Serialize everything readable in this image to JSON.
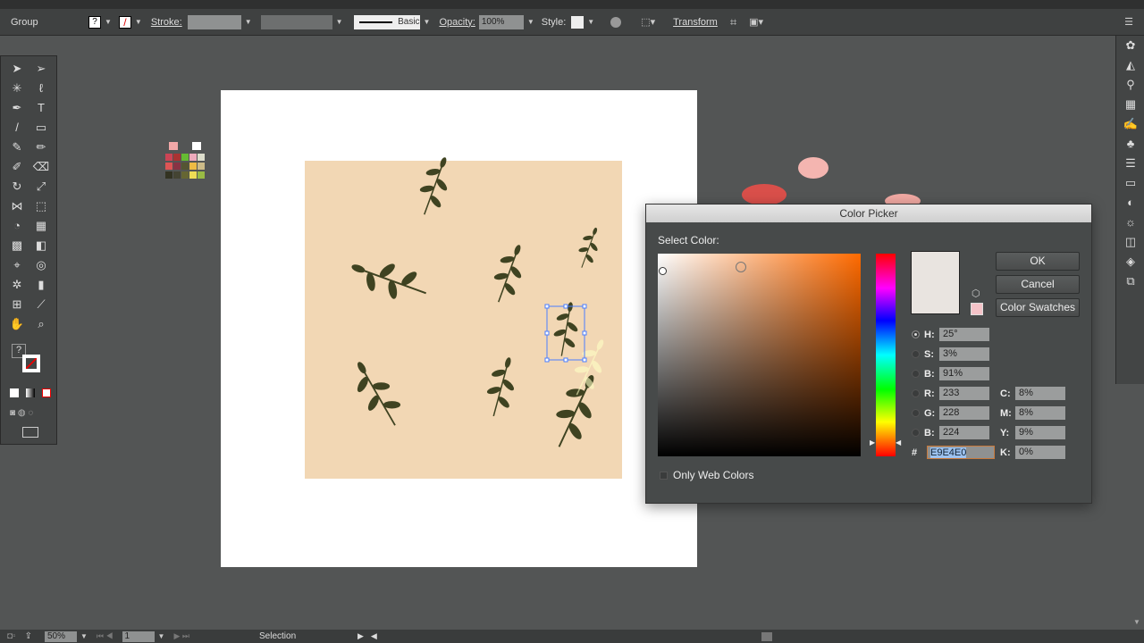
{
  "control_bar": {
    "selection_type": "Group",
    "stroke_label": "Stroke:",
    "brush_label": "Basic",
    "opacity_label": "Opacity:",
    "opacity_value": "100%",
    "style_label": "Style:",
    "transform_label": "Transform"
  },
  "status_bar": {
    "zoom": "50%",
    "artboard": "1",
    "tool": "Selection"
  },
  "dialog": {
    "title": "Color Picker",
    "select_label": "Select Color:",
    "ok": "OK",
    "cancel": "Cancel",
    "swatches": "Color Swatches",
    "only_web": "Only Web Colors",
    "fields": {
      "H": {
        "label": "H:",
        "value": "25°"
      },
      "S": {
        "label": "S:",
        "value": "3%"
      },
      "Bv": {
        "label": "B:",
        "value": "91%"
      },
      "R": {
        "label": "R:",
        "value": "233"
      },
      "G": {
        "label": "G:",
        "value": "228"
      },
      "Bl": {
        "label": "B:",
        "value": "224"
      },
      "C": {
        "label": "C:",
        "value": "8%"
      },
      "M": {
        "label": "M:",
        "value": "8%"
      },
      "Y": {
        "label": "Y:",
        "value": "9%"
      },
      "K": {
        "label": "K:",
        "value": "0%"
      }
    },
    "hex_label": "#",
    "hex": "E9E4E0",
    "new_color": "#e9e4e0",
    "old_color": "#f4c3c8"
  },
  "colors": {
    "peach": "#f2d7b4",
    "leaf": "#3f4321"
  }
}
